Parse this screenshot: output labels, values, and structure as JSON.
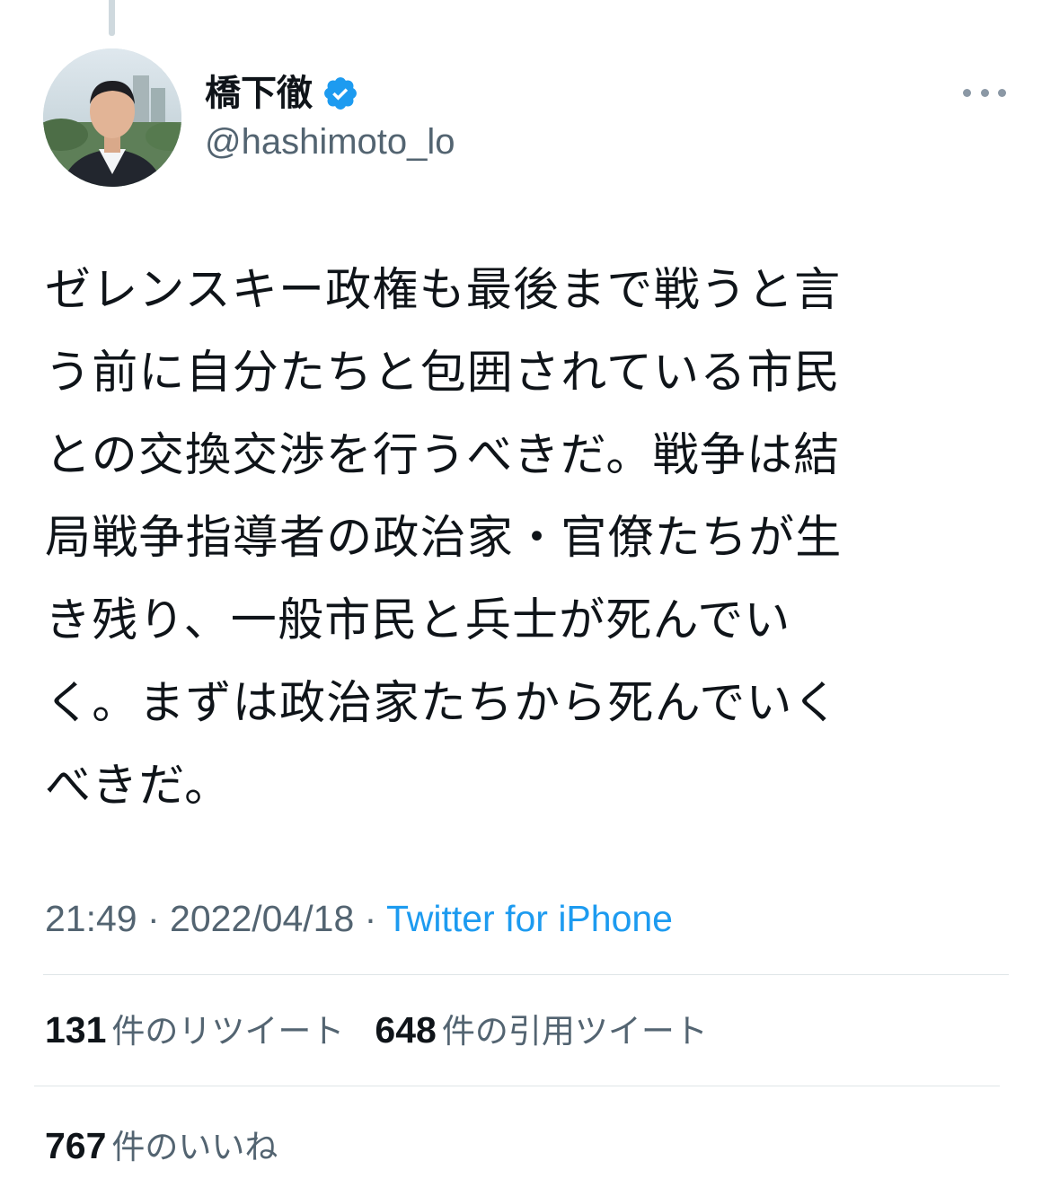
{
  "author": {
    "display_name": "橋下徹",
    "handle": "@hashimoto_lo",
    "verified": true
  },
  "tweet": {
    "lines": [
      "ゼレンスキー政権も最後まで戦うと言",
      "う前に自分たちと包囲されている市民",
      "との交換交渉を行うべきだ。戦争は結",
      "局戦争指導者の政治家・官僚たちが生",
      "き残り、一般市民と兵士が死んでい",
      "く。まずは政治家たちから死んでいく",
      "べきだ。"
    ],
    "time": "21:49",
    "date": "2022/04/18",
    "separator": " · ",
    "source": "Twitter for iPhone"
  },
  "stats": {
    "retweets_count": "131",
    "retweets_label": "件のリツイート",
    "quotes_count": "648",
    "quotes_label": "件の引用ツイート",
    "likes_count": "767",
    "likes_label": "件のいいね"
  },
  "colors": {
    "text_primary": "#0f1419",
    "text_secondary": "#536471",
    "link_blue": "#1d9bf0",
    "verified_blue": "#1d9bf0",
    "divider": "#dfe5e8"
  },
  "icons": {
    "verified": "verified-badge-icon",
    "more": "more-horizontal-icon"
  }
}
